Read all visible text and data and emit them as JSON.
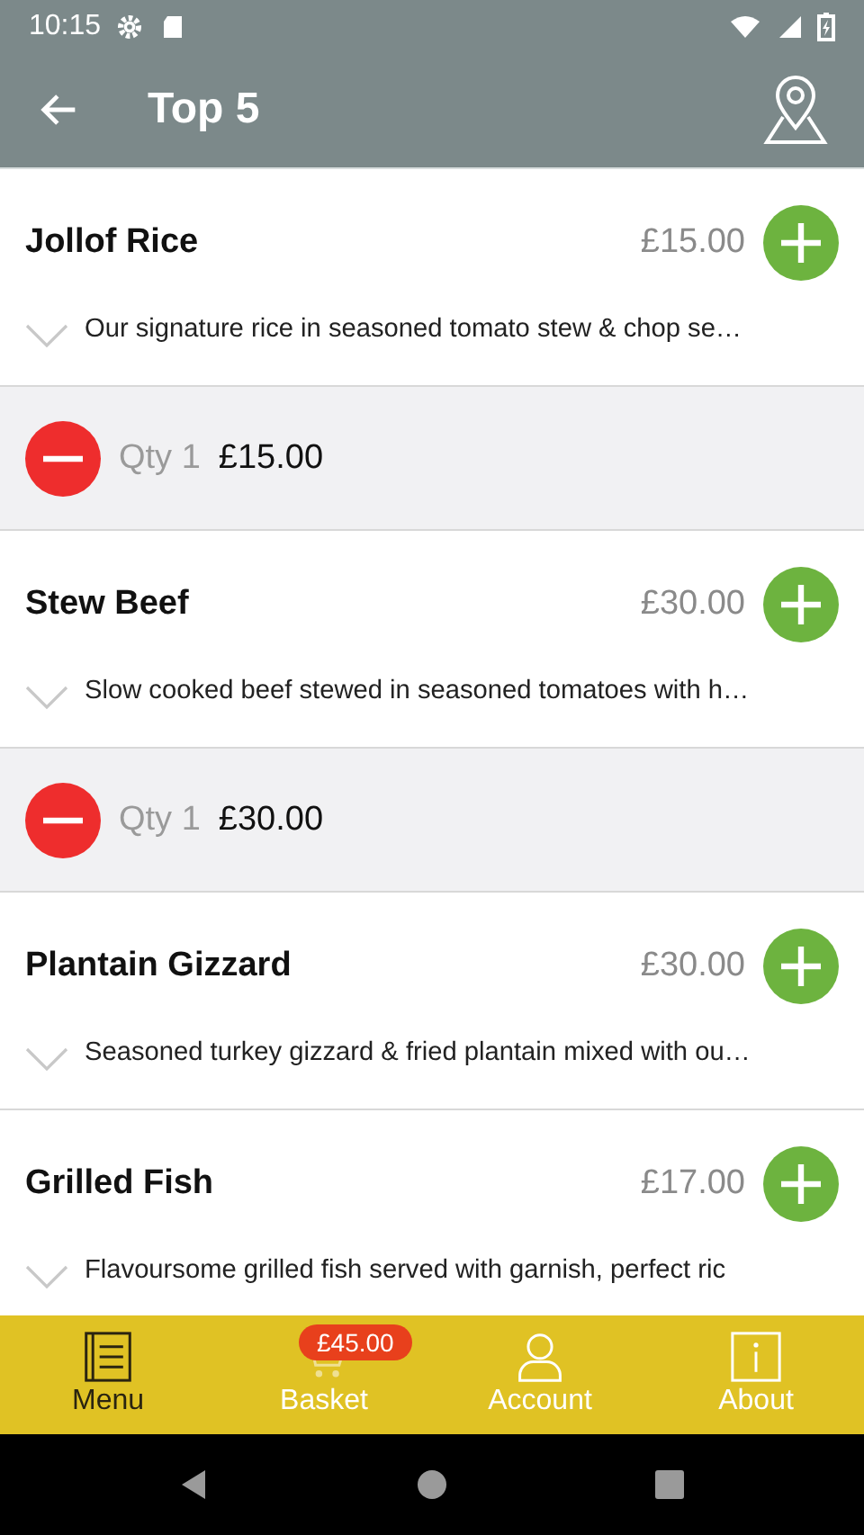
{
  "status_bar": {
    "time": "10:15"
  },
  "app_bar": {
    "title": "Top 5"
  },
  "items": [
    {
      "name": "Jollof Rice",
      "price": "£15.00",
      "description": "Our signature rice in seasoned tomato stew & chop se…",
      "expanded": false,
      "basket": {
        "qty": "Qty 1",
        "total": "£15.00"
      }
    },
    {
      "name": "Stew Beef",
      "price": "£30.00",
      "description": "Slow cooked beef stewed in seasoned tomatoes with h…",
      "expanded": false,
      "basket": {
        "qty": "Qty 1",
        "total": "£30.00"
      }
    },
    {
      "name": "Plantain Gizzard",
      "price": "£30.00",
      "description": "Seasoned turkey gizzard & fried plantain mixed with ou…",
      "expanded": false
    },
    {
      "name": "Grilled Fish",
      "price": "£17.00",
      "description": "Flavoursome grilled fish served with garnish, perfect ric",
      "expanded": false
    }
  ],
  "nav": [
    {
      "kind": "menu",
      "label": "Menu",
      "selected": true
    },
    {
      "kind": "basket",
      "label": "Basket",
      "selected": false,
      "badge": "£45.00"
    },
    {
      "kind": "account",
      "label": "Account",
      "selected": false
    },
    {
      "kind": "about",
      "label": "About",
      "selected": false
    }
  ]
}
